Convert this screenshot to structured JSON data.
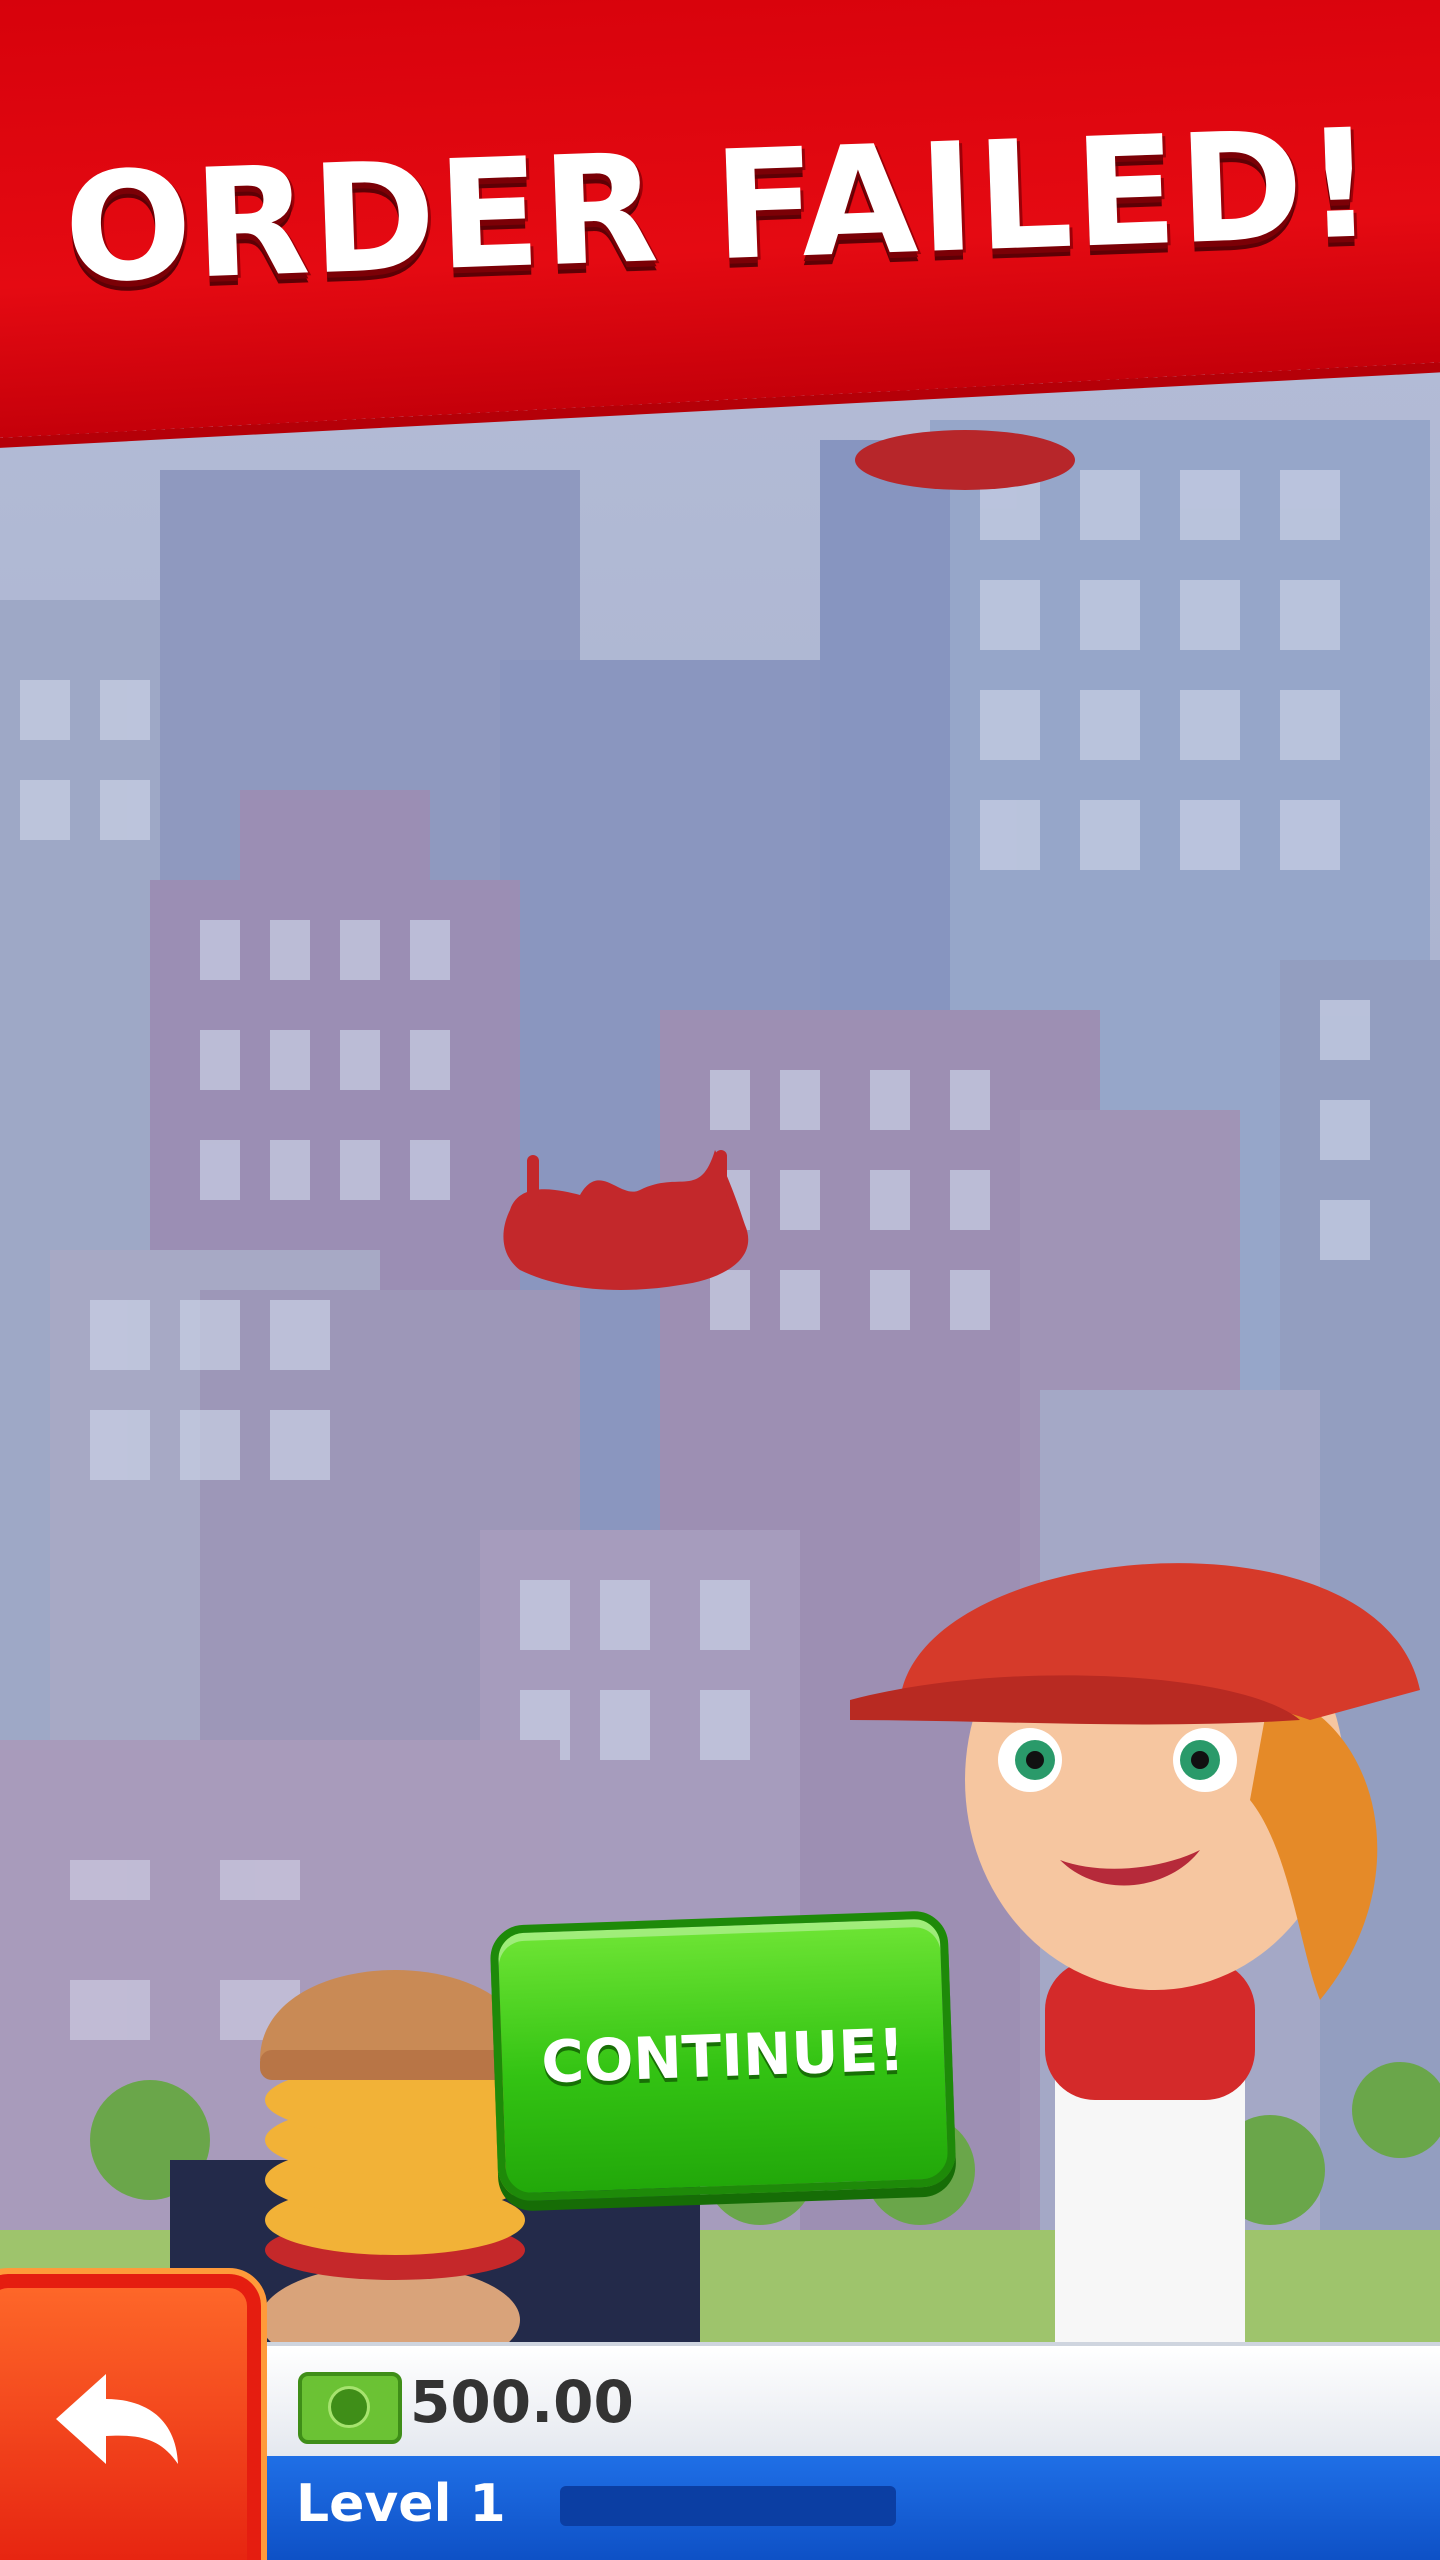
{
  "banner": {
    "title": "ORDER FAILED!"
  },
  "continue_button": {
    "label": "CONTINUE!"
  },
  "hud": {
    "money": "500.00",
    "level": "Level 1",
    "level_progress": 0.0
  },
  "colors": {
    "banner_red": "#e50a12",
    "continue_green": "#33c313",
    "hud_blue": "#1f6fe6",
    "back_orange": "#e41d0e"
  },
  "icons": [
    "back-arrow-icon",
    "money-bill-icon"
  ]
}
